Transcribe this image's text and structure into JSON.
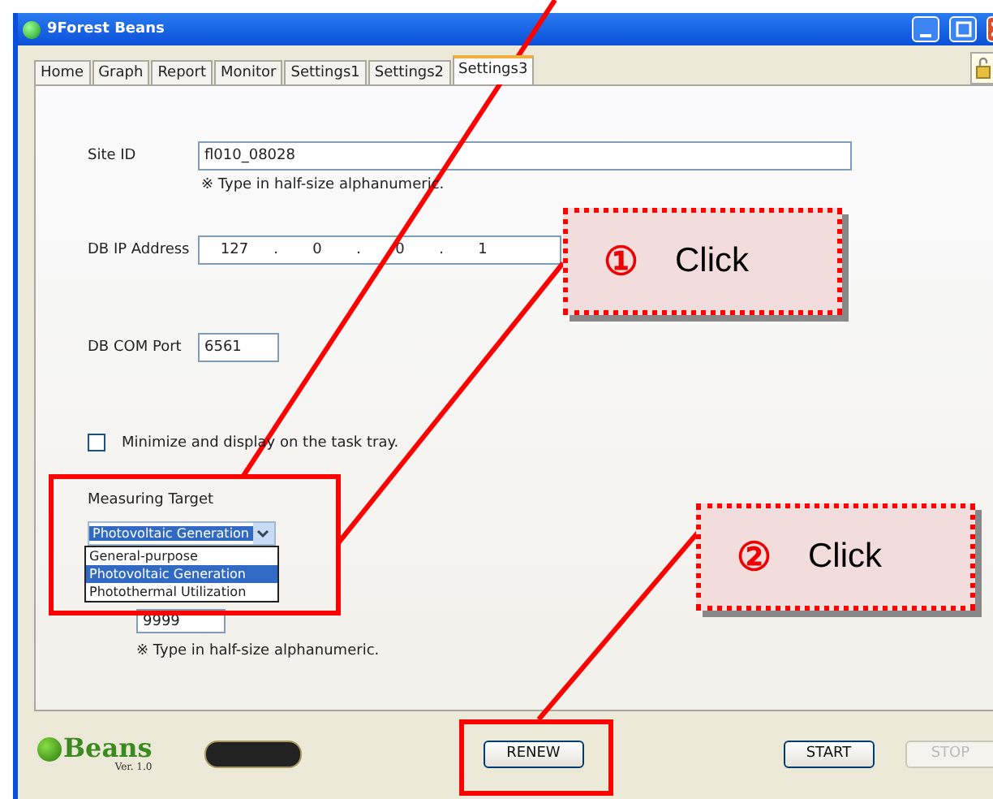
{
  "window": {
    "title": "9Forest Beans"
  },
  "tabs": [
    {
      "label": "Home",
      "selected": false
    },
    {
      "label": "Graph",
      "selected": false
    },
    {
      "label": "Report",
      "selected": false
    },
    {
      "label": "Monitor",
      "selected": false
    },
    {
      "label": "Settings1",
      "selected": false
    },
    {
      "label": "Settings2",
      "selected": false
    },
    {
      "label": "Settings3",
      "selected": true
    }
  ],
  "form": {
    "site_id": {
      "label": "Site ID",
      "value": "fl010_08028",
      "note": "※ Type in half-size alphanumeric."
    },
    "db_ip": {
      "label": "DB IP Address",
      "octets": [
        "127",
        "0",
        "0",
        "1"
      ],
      "separator": "."
    },
    "db_port": {
      "label": "DB COM Port",
      "value": "6561"
    },
    "tray": {
      "label": "Minimize and display on the task tray.",
      "checked": false
    },
    "measuring_target": {
      "label": "Measuring Target",
      "value": "Photovoltaic Generation",
      "options": [
        {
          "label": "General-purpose",
          "selected": false
        },
        {
          "label": "Photovoltaic Generation",
          "selected": true
        },
        {
          "label": "Photothermal Utilization",
          "selected": false
        }
      ]
    },
    "port_2": {
      "value": "9999",
      "note": "※ Type in half-size alphanumeric."
    }
  },
  "footer": {
    "logo": "Beans",
    "version": "Ver. 1.0",
    "buttons": [
      {
        "label": "RENEW",
        "disabled": false
      },
      {
        "label": "START",
        "disabled": false
      },
      {
        "label": "STOP",
        "disabled": true
      }
    ]
  },
  "callouts": [
    {
      "number": "①",
      "text": "Click"
    },
    {
      "number": "②",
      "text": "Click"
    }
  ]
}
